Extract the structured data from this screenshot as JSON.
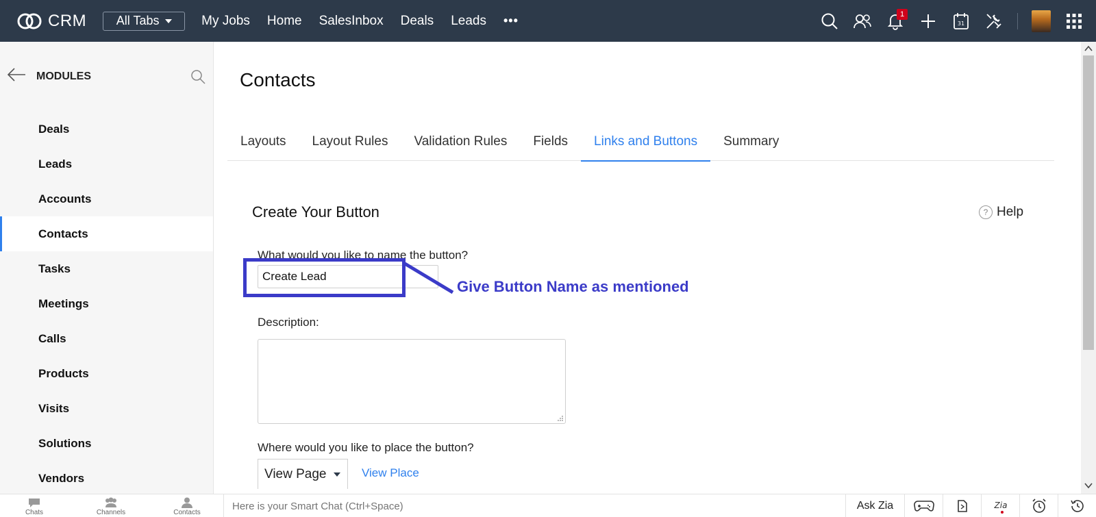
{
  "topbar": {
    "brand": "CRM",
    "all_tabs": "All Tabs",
    "nav": [
      "My Jobs",
      "Home",
      "SalesInbox",
      "Deals",
      "Leads"
    ],
    "more": "•••",
    "notification_count": "1",
    "icons": [
      "search-icon",
      "contacts-icon",
      "bell-icon",
      "plus-icon",
      "calendar-icon",
      "tools-icon",
      "avatar",
      "apps-grid-icon"
    ]
  },
  "sidebar": {
    "title": "MODULES",
    "items": [
      "Deals",
      "Leads",
      "Accounts",
      "Contacts",
      "Tasks",
      "Meetings",
      "Calls",
      "Products",
      "Visits",
      "Solutions",
      "Vendors"
    ],
    "active": "Contacts"
  },
  "main": {
    "page_title": "Contacts",
    "tabs": [
      "Layouts",
      "Layout Rules",
      "Validation Rules",
      "Fields",
      "Links and Buttons",
      "Summary"
    ],
    "active_tab": "Links and Buttons",
    "section_title": "Create Your Button",
    "help": "Help",
    "name_label": "What would you like to name the button?",
    "name_value": "Create Lead",
    "callout": "Give Button Name as mentioned",
    "description_label": "Description:",
    "place_label": "Where would you like to place the button?",
    "place_value": "View Page",
    "view_place_link": "View Place"
  },
  "bottombar": {
    "chats": "Chats",
    "channels": "Channels",
    "contacts": "Contacts",
    "chat_placeholder": "Here is your Smart Chat (Ctrl+Space)",
    "ask_zia": "Ask Zia"
  },
  "colors": {
    "topbar_bg": "#2d3a4a",
    "accent": "#2f80ed",
    "annotation": "#3b3bc8",
    "badge": "#d0021b"
  }
}
